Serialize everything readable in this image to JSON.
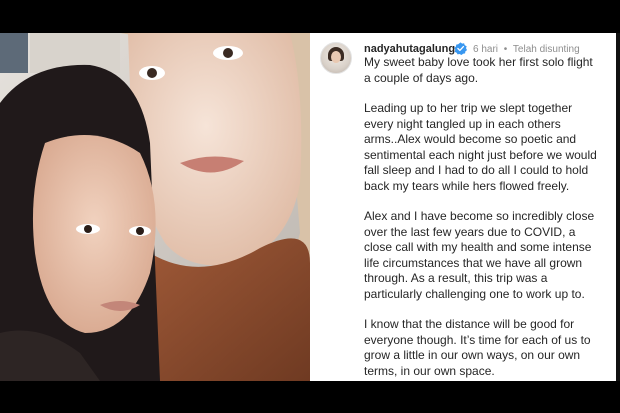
{
  "post": {
    "username": "nadyahutagalung",
    "time": "6 hari",
    "separator": "•",
    "edited": "Telah disunting",
    "paragraphs": [
      "My sweet baby love took her first solo flight a couple of days ago.",
      "Leading up to her trip we slept together every night tangled up in each others arms..Alex would become so poetic and sentimental each night just before we would fall sleep and I had to do all I could to hold back my tears while hers flowed freely.",
      "Alex and I have become so incredibly close over the last few years due to COVID, a close call with my health and some intense life circumstances that we have all grown through. As a result, this trip was a particularly challenging one to work up to.",
      "I know that the distance will be good for everyone though. It’s time for each of us to grow a little in our own ways, on our own terms, in our own space."
    ]
  },
  "icons": {
    "verified": "verified-badge-icon",
    "avatar": "profile-avatar"
  },
  "colors": {
    "verified_blue": "#3897f0",
    "text": "#262626",
    "muted": "#8e8e8e"
  }
}
